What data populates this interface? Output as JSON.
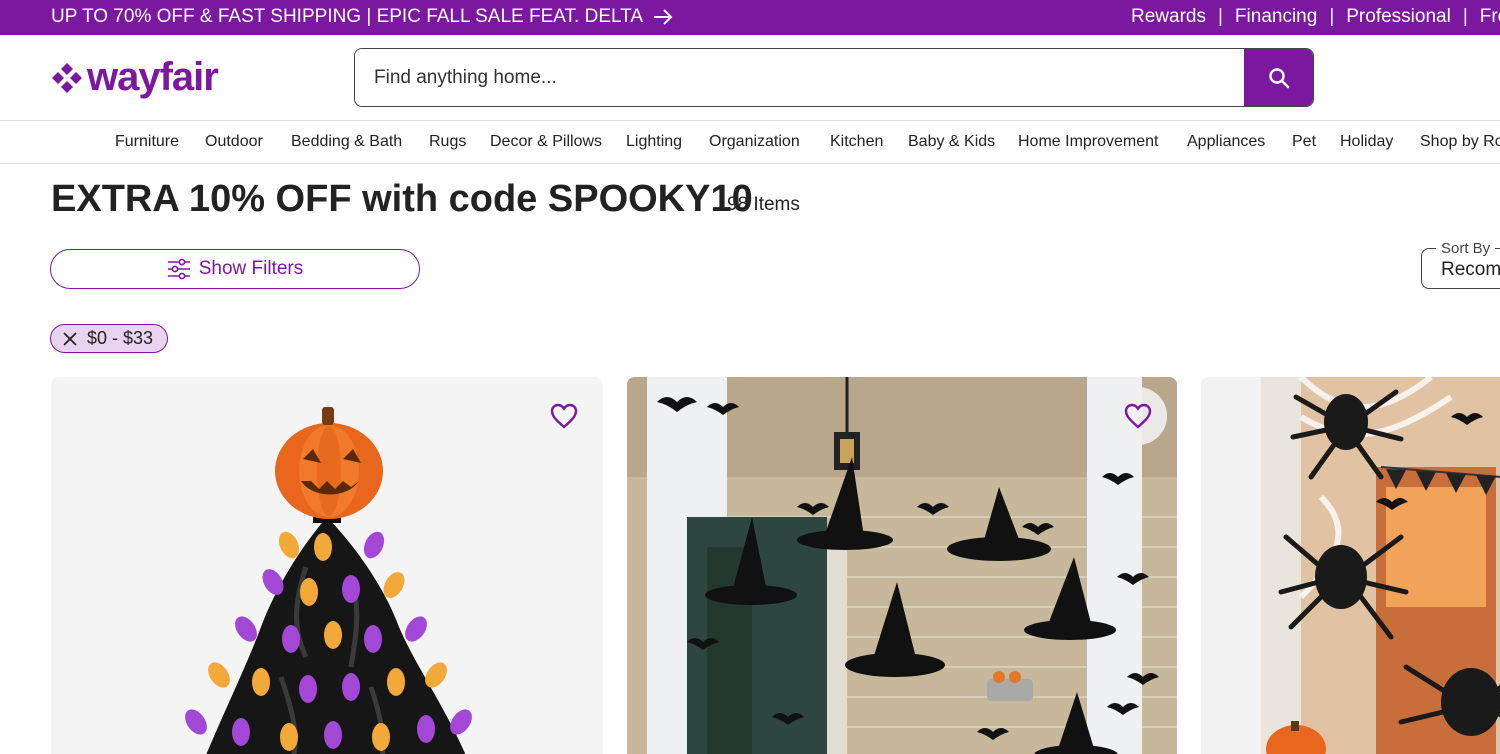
{
  "promo": {
    "text": "UP TO 70% OFF & FAST SHIPPING | EPIC FALL SALE FEAT. DELTA",
    "links": [
      "Rewards",
      "Financing",
      "Professional",
      "Fre"
    ]
  },
  "header": {
    "logo_text": "wayfair",
    "search_placeholder": "Find anything home..."
  },
  "nav": {
    "items": [
      "Furniture",
      "Outdoor",
      "Bedding & Bath",
      "Rugs",
      "Decor & Pillows",
      "Lighting",
      "Organization",
      "Kitchen",
      "Baby & Kids",
      "Home Improvement",
      "Appliances",
      "Pet",
      "Holiday",
      "Shop by Ro"
    ]
  },
  "page": {
    "title": "EXTRA 10% OFF with code SPOOKY10",
    "item_count": "98 Items"
  },
  "filters": {
    "show_filters_label": "Show Filters",
    "sort_label": "Sort By",
    "sort_value": "Recom",
    "active_chip": "$0 - $33"
  },
  "colors": {
    "brand": "#7b189f",
    "chip_bg": "#e8d4f0"
  },
  "icons": {
    "promo_arrow": "arrow-right-icon",
    "search": "search-icon",
    "filters": "sliders-icon",
    "chip_remove": "close-icon",
    "favorite": "heart-icon"
  }
}
